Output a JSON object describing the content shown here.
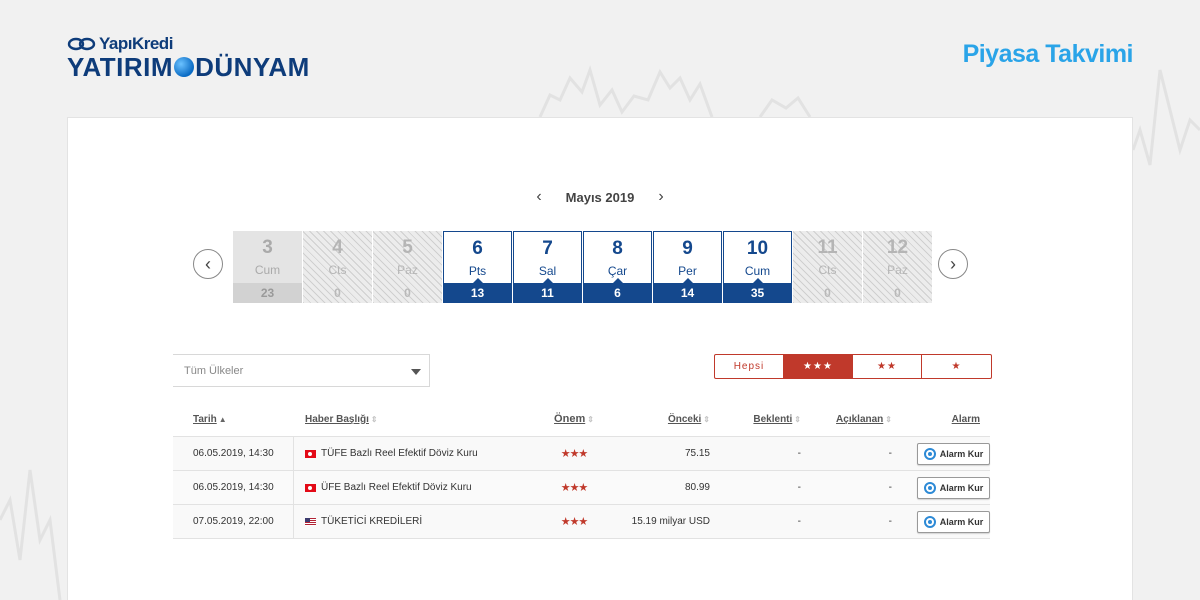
{
  "brand": {
    "top": "YapıKredi",
    "bottom_left": "YATIRIM",
    "bottom_right": "DÜNYAM"
  },
  "page_title": "Piyasa Takvimi",
  "month_nav": {
    "label": "Mayıs 2019",
    "prev_icon": "chevron-left-icon",
    "next_icon": "chevron-right-icon"
  },
  "days": [
    {
      "num": "3",
      "name": "Cum",
      "count": "23",
      "state": "past"
    },
    {
      "num": "4",
      "name": "Cts",
      "count": "0",
      "state": "hatch"
    },
    {
      "num": "5",
      "name": "Paz",
      "count": "0",
      "state": "hatch"
    },
    {
      "num": "6",
      "name": "Pts",
      "count": "13",
      "state": "active"
    },
    {
      "num": "7",
      "name": "Sal",
      "count": "11",
      "state": "active"
    },
    {
      "num": "8",
      "name": "Çar",
      "count": "6",
      "state": "active"
    },
    {
      "num": "9",
      "name": "Per",
      "count": "14",
      "state": "active"
    },
    {
      "num": "10",
      "name": "Cum",
      "count": "35",
      "state": "active"
    },
    {
      "num": "11",
      "name": "Cts",
      "count": "0",
      "state": "hatch"
    },
    {
      "num": "12",
      "name": "Paz",
      "count": "0",
      "state": "hatch"
    }
  ],
  "filters": {
    "country_select": "Tüm Ülkeler",
    "star_options": [
      "Hepsi",
      "★★★",
      "★★",
      "★"
    ],
    "star_selected_index": 1
  },
  "table": {
    "headers": {
      "date": "Tarih",
      "title": "Haber Başlığı",
      "importance": "Önem",
      "previous": "Önceki",
      "expected": "Beklenti",
      "actual": "Açıklanan",
      "alarm": "Alarm"
    },
    "rows": [
      {
        "date": "06.05.2019, 14:30",
        "flag": "tr",
        "title": "TÜFE Bazlı Reel Efektif Döviz Kuru",
        "stars": "★★★",
        "previous": "75.15",
        "expected": "-",
        "actual": "-",
        "alarm": "Alarm Kur"
      },
      {
        "date": "06.05.2019, 14:30",
        "flag": "tr",
        "title": "ÜFE Bazlı Reel Efektif Döviz Kuru",
        "stars": "★★★",
        "previous": "80.99",
        "expected": "-",
        "actual": "-",
        "alarm": "Alarm Kur"
      },
      {
        "date": "07.05.2019, 22:00",
        "flag": "us",
        "title": "TÜKETİCİ KREDİLERİ",
        "stars": "★★★",
        "previous": "15.19 milyar USD",
        "expected": "-",
        "actual": "-",
        "alarm": "Alarm Kur"
      }
    ]
  },
  "colors": {
    "navy": "#14488d",
    "red": "#c0392b",
    "accent": "#2aa4e8"
  }
}
